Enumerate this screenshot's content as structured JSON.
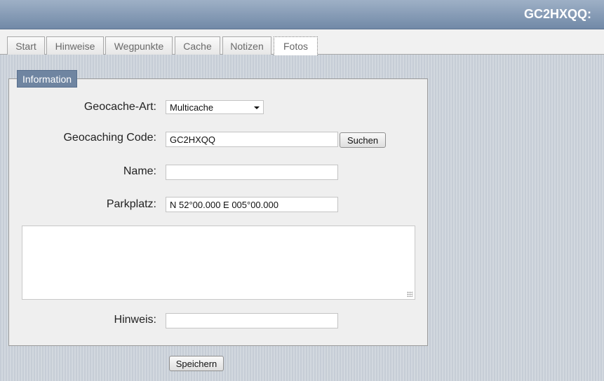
{
  "header": {
    "title": "GC2HXQQ:"
  },
  "tabs": [
    {
      "label": "Start",
      "active": false
    },
    {
      "label": "Hinweise",
      "active": false
    },
    {
      "label": "Wegpunkte",
      "active": false
    },
    {
      "label": "Cache",
      "active": false
    },
    {
      "label": "Notizen",
      "active": false
    },
    {
      "label": "Fotos",
      "active": true
    }
  ],
  "form": {
    "legend": "Information",
    "cache_type": {
      "label": "Geocache-Art:",
      "selected": "Multicache"
    },
    "code": {
      "label": "Geocaching Code:",
      "value": "GC2HXQQ",
      "button_label": "Suchen"
    },
    "name": {
      "label": "Name:",
      "value": ""
    },
    "parking": {
      "label": "Parkplatz:",
      "value": "N 52°00.000 E 005°00.000"
    },
    "description": {
      "value": ""
    },
    "hint": {
      "label": "Hinweis:",
      "value": ""
    },
    "save_label": "Speichern"
  },
  "colors": {
    "header_gradient_top": "#9eb0c6",
    "header_gradient_bottom": "#7189a7",
    "legend_bg": "#6f85a1"
  }
}
